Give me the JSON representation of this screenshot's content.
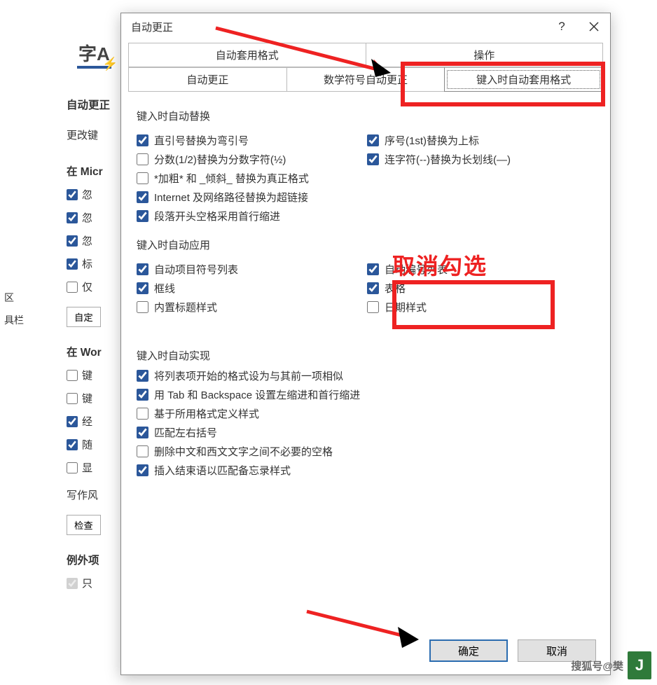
{
  "dialog": {
    "title": "自动更正",
    "tabs_row1": [
      "自动套用格式",
      "操作"
    ],
    "tabs_row2": [
      "自动更正",
      "数学符号自动更正",
      "键入时自动套用格式"
    ],
    "active_tab_index_row2": 2,
    "groups": {
      "replace": {
        "label": "键入时自动替换",
        "left": [
          {
            "label": "直引号替换为弯引号",
            "checked": true
          },
          {
            "label": "分数(1/2)替换为分数字符(½)",
            "checked": false
          },
          {
            "label": "*加粗* 和 _倾斜_ 替换为真正格式",
            "checked": false
          },
          {
            "label": "Internet 及网络路径替换为超链接",
            "checked": true
          },
          {
            "label": "段落开头空格采用首行缩进",
            "checked": true
          }
        ],
        "right": [
          {
            "label": "序号(1st)替换为上标",
            "checked": true
          },
          {
            "label": "连字符(--)替换为长划线(—)",
            "checked": true
          }
        ]
      },
      "apply": {
        "label": "键入时自动应用",
        "left": [
          {
            "label": "自动项目符号列表",
            "checked": true
          },
          {
            "label": "框线",
            "checked": true
          },
          {
            "label": "内置标题样式",
            "checked": false
          }
        ],
        "right": [
          {
            "label": "自动编号列表",
            "checked": true
          },
          {
            "label": "表格",
            "checked": true
          },
          {
            "label": "日期样式",
            "checked": false
          }
        ]
      },
      "auto": {
        "label": "键入时自动实现",
        "items": [
          {
            "label": "将列表项开始的格式设为与其前一项相似",
            "checked": true
          },
          {
            "label": "用 Tab 和 Backspace 设置左缩进和首行缩进",
            "checked": true
          },
          {
            "label": "基于所用格式定义样式",
            "checked": false
          },
          {
            "label": "匹配左右括号",
            "checked": true
          },
          {
            "label": "删除中文和西文文字之间不必要的空格",
            "checked": false
          },
          {
            "label": "插入结束语以匹配备忘录样式",
            "checked": true
          }
        ]
      }
    },
    "buttons": {
      "ok": "确定",
      "cancel": "取消"
    }
  },
  "annotations": {
    "uncheck_label": "取消勾选"
  },
  "background": {
    "icon_text": "字A",
    "headings": {
      "auto_correct": "自动更正",
      "change": "更改键",
      "in_micro": "在 Micr",
      "in_word": "在 Wor",
      "write_style": "写作风",
      "exception": "例外项"
    },
    "rows": {
      "ig1": "忽",
      "ig2": "忽",
      "ig3": "忽",
      "mark": "标",
      "only": "仅",
      "custom_btn": "自定",
      "key1": "键",
      "key2": "键",
      "often": "经",
      "with": "随",
      "show": "显",
      "check_btn": "检查",
      "only2": "只"
    },
    "left_nav_items": [
      "区",
      "具栏"
    ]
  },
  "watermark": {
    "text": "搜狐号@樊",
    "badge": "J"
  }
}
